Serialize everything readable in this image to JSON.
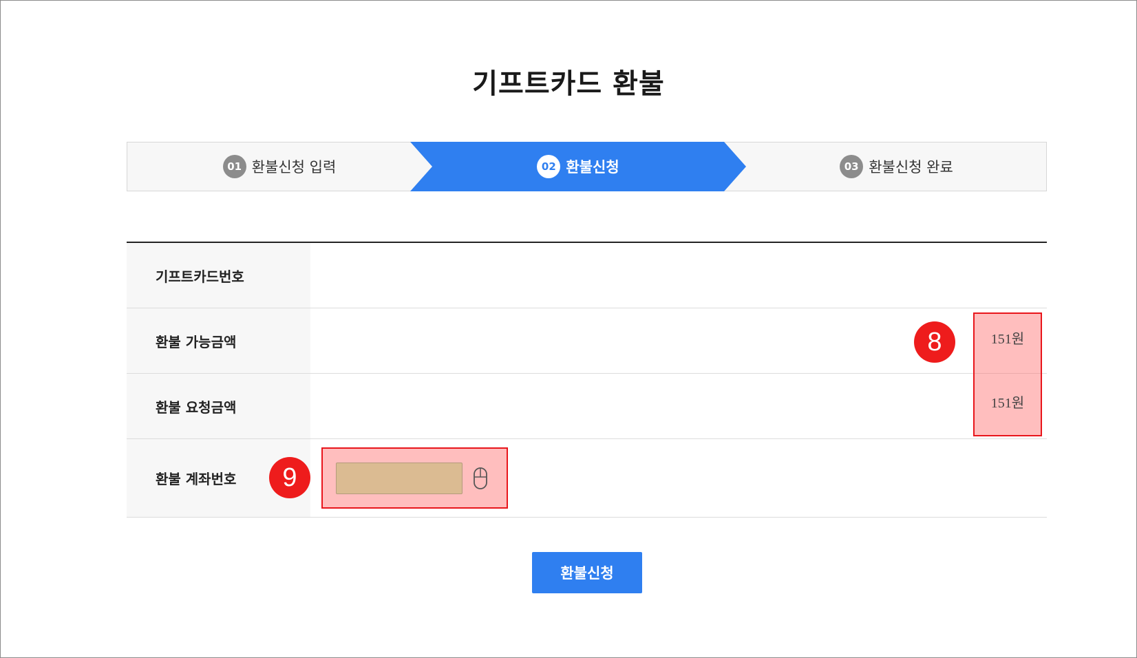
{
  "page": {
    "title": "기프트카드 환불"
  },
  "stepper": {
    "steps": [
      {
        "num": "01",
        "label": "환불신청 입력",
        "active": false
      },
      {
        "num": "02",
        "label": "환불신청",
        "active": true
      },
      {
        "num": "03",
        "label": "환불신청 완료",
        "active": false
      }
    ],
    "colors": {
      "active": "#2f7ff0",
      "inactive": "#f7f7f7"
    }
  },
  "form": {
    "rows": [
      {
        "label": "기프트카드번호",
        "value": ""
      },
      {
        "label": "환불 가능금액",
        "value": "151원"
      },
      {
        "label": "환불 요청금액",
        "value": "151원"
      },
      {
        "label": "환불 계좌번호",
        "value": ""
      }
    ],
    "account_input": {
      "value": "",
      "placeholder": ""
    }
  },
  "annotations": {
    "marker_8": "8",
    "marker_9": "9",
    "highlight_color": "#e8151b"
  },
  "actions": {
    "submit_label": "환불신청"
  },
  "icons": {
    "mouse": "mouse-icon"
  }
}
